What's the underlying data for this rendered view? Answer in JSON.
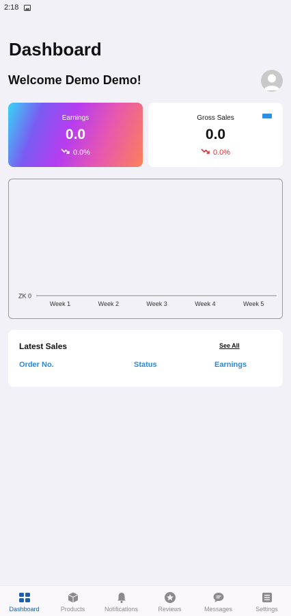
{
  "status_bar": {
    "time": "2:18",
    "icon": "image-icon"
  },
  "header": {
    "title": "Dashboard",
    "welcome": "Welcome Demo Demo!",
    "avatar_icon": "user-avatar-icon"
  },
  "cards": {
    "earnings": {
      "label": "Earnings",
      "value": "0.0",
      "change": "0.0%",
      "trend_icon": "trending-down-icon"
    },
    "gross_sales": {
      "label": "Gross Sales",
      "value": "0.0",
      "change": "0.0%",
      "trend_icon": "trending-down-icon",
      "change_color": "#d93232"
    }
  },
  "chart_data": {
    "type": "line",
    "categories": [
      "Week 1",
      "Week 2",
      "Week 3",
      "Week 4",
      "Week 5"
    ],
    "values": [
      0,
      0,
      0,
      0,
      0
    ],
    "y_tick_labels": [
      "ZK 0"
    ],
    "title": "",
    "xlabel": "",
    "ylabel": ""
  },
  "latest_sales": {
    "title": "Latest Sales",
    "see_all": "See All",
    "columns": [
      "Order No.",
      "Status",
      "Earnings"
    ]
  },
  "bottom_nav": {
    "active": "Dashboard",
    "items": [
      {
        "label": "Dashboard",
        "icon": "grid-icon"
      },
      {
        "label": "Products",
        "icon": "box-icon"
      },
      {
        "label": "Notifications",
        "icon": "bell-icon"
      },
      {
        "label": "Reviews",
        "icon": "star-icon"
      },
      {
        "label": "Messages",
        "icon": "chat-icon"
      },
      {
        "label": "Settings",
        "icon": "list-icon"
      }
    ]
  },
  "colors": {
    "accent": "#2a8ad9",
    "nav_active": "#1f5ea8",
    "background": "#f2f1f7"
  }
}
